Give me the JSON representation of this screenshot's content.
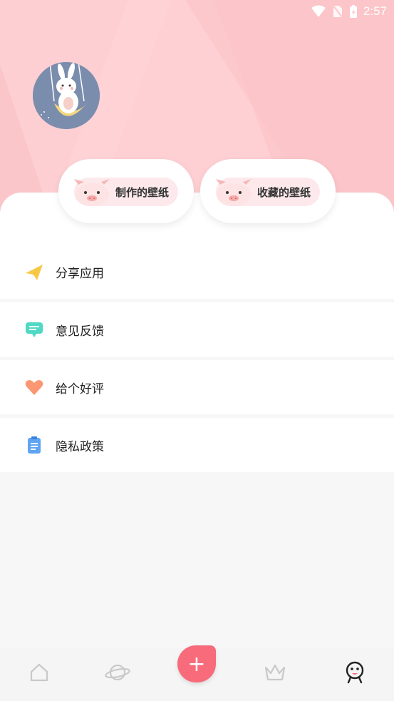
{
  "status": {
    "time": "2:57"
  },
  "pills": [
    {
      "label": "制作的壁纸"
    },
    {
      "label": "收藏的壁纸"
    }
  ],
  "menu": [
    {
      "label": "分享应用",
      "icon": "paper-plane-icon"
    },
    {
      "label": "意见反馈",
      "icon": "feedback-chat-icon"
    },
    {
      "label": "给个好评",
      "icon": "heart-icon"
    },
    {
      "label": "隐私政策",
      "icon": "clipboard-icon"
    }
  ],
  "tabbar": {
    "items": [
      "home-icon",
      "planet-icon",
      "add-button",
      "crown-icon",
      "profile-icon"
    ],
    "fab_label": "+",
    "active": "profile-icon"
  },
  "colors": {
    "header": "#fcc8cc",
    "accent": "#f76b7b",
    "pill_inner": "#fde9eb"
  }
}
